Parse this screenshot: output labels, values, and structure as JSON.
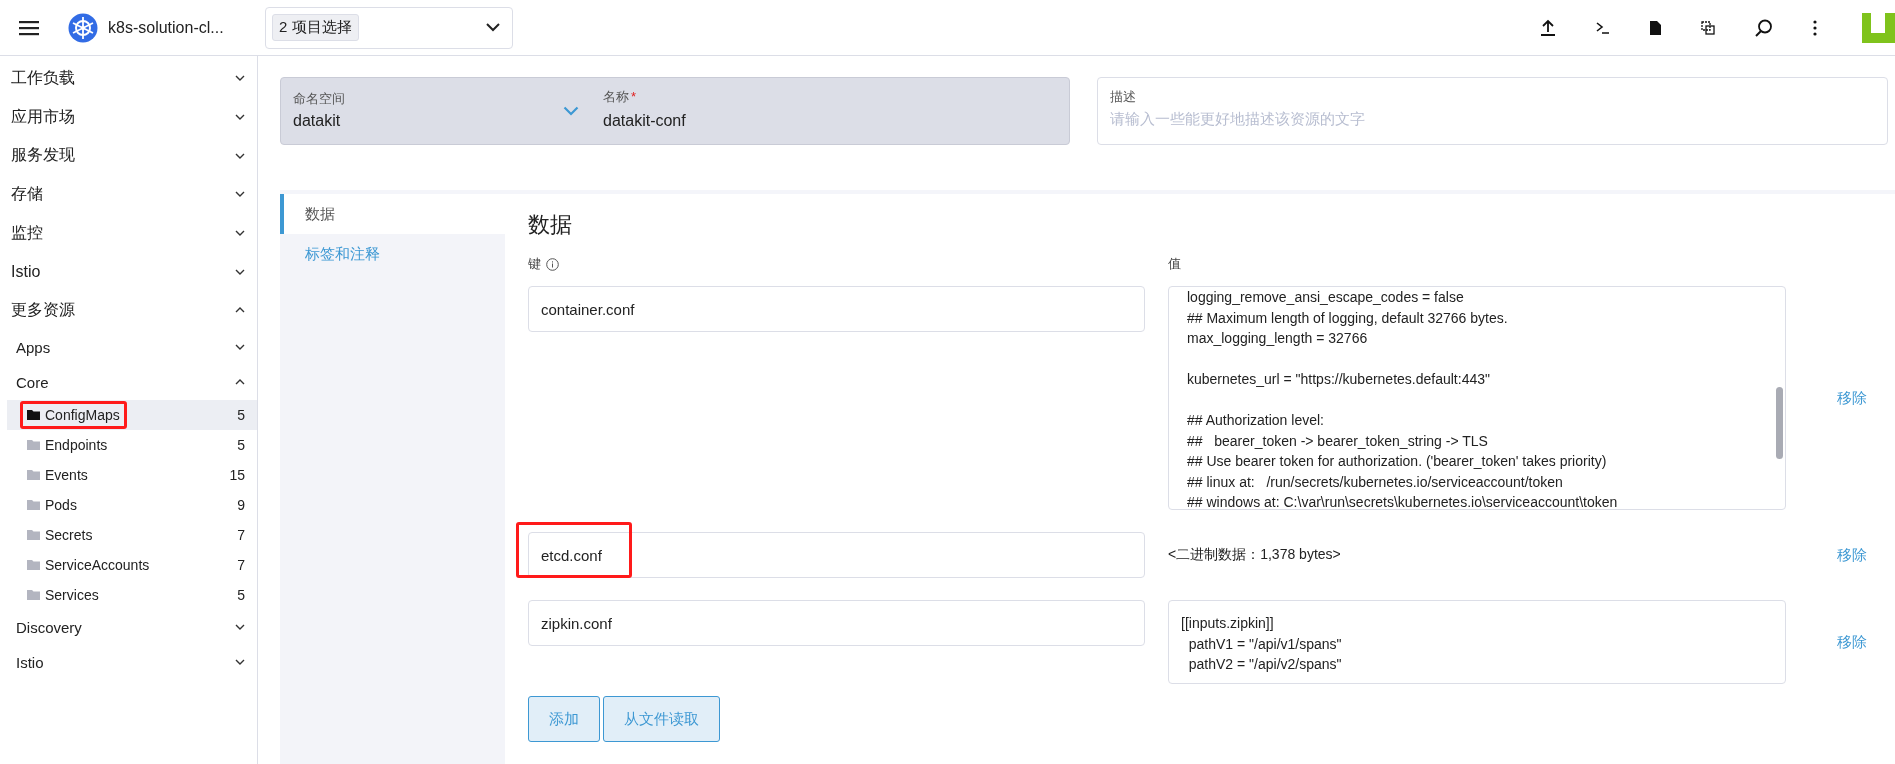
{
  "header": {
    "cluster_name": "k8s-solution-cl...",
    "project_select": {
      "value": "2 项目选择"
    }
  },
  "sidebar": {
    "items": [
      {
        "label": "工作负载",
        "expanded": false
      },
      {
        "label": "应用市场",
        "expanded": false
      },
      {
        "label": "服务发现",
        "expanded": false
      },
      {
        "label": "存储",
        "expanded": false
      },
      {
        "label": "监控",
        "expanded": false
      },
      {
        "label": "Istio",
        "expanded": false
      },
      {
        "label": "更多资源",
        "expanded": true,
        "children": [
          {
            "label": "Apps",
            "expanded": false
          },
          {
            "label": "Core",
            "expanded": true,
            "children": [
              {
                "label": "ConfigMaps",
                "count": "5",
                "selected": true,
                "annotated": true
              },
              {
                "label": "Endpoints",
                "count": "5",
                "selected": false,
                "annotated": false
              },
              {
                "label": "Events",
                "count": "15",
                "selected": false,
                "annotated": false
              },
              {
                "label": "Pods",
                "count": "9",
                "selected": false,
                "annotated": false
              },
              {
                "label": "Secrets",
                "count": "7",
                "selected": false,
                "annotated": false
              },
              {
                "label": "ServiceAccounts",
                "count": "7",
                "selected": false,
                "annotated": false
              },
              {
                "label": "Services",
                "count": "5",
                "selected": false,
                "annotated": false
              }
            ]
          },
          {
            "label": "Discovery",
            "expanded": false
          },
          {
            "label": "Istio",
            "expanded": false
          }
        ]
      }
    ]
  },
  "form": {
    "namespace": {
      "label": "命名空间",
      "value": "datakit"
    },
    "name": {
      "label": "名称",
      "required_mark": "*",
      "value": "datakit-conf"
    },
    "description": {
      "label": "描述",
      "placeholder": "请输入一些能更好地描述该资源的文字"
    }
  },
  "tabs": [
    {
      "label": "数据",
      "selected": true
    },
    {
      "label": "标签和注释",
      "selected": false
    }
  ],
  "data_panel": {
    "title": "数据",
    "key_header": "键",
    "value_header": "值",
    "entries": [
      {
        "key": "container.conf",
        "kind": "text",
        "annotated": false,
        "remove": "移除",
        "value_blocks": [
          [
            "logging_remove_ansi_escape_codes = false",
            "## Maximum length of logging, default 32766 bytes.",
            "max_logging_length = 32766"
          ],
          [
            "kubernetes_url = \"https://kubernetes.default:443\""
          ],
          [
            "## Authorization level:",
            "##   bearer_token -> bearer_token_string -> TLS",
            "## Use bearer token for authorization. ('bearer_token' takes priority)",
            "## linux at:   /run/secrets/kubernetes.io/serviceaccount/token",
            "## windows at: C:\\var\\run\\secrets\\kubernetes.io\\serviceaccount\\token"
          ]
        ]
      },
      {
        "key": "etcd.conf",
        "kind": "binary",
        "annotated": true,
        "remove": "移除",
        "value": "<二进制数据：1,378 bytes>"
      },
      {
        "key": "zipkin.conf",
        "kind": "text",
        "annotated": false,
        "remove": "移除",
        "value_blocks": [
          [
            "[[inputs.zipkin]]",
            "  pathV1 = \"/api/v1/spans\"",
            "  pathV2 = \"/api/v2/spans\""
          ]
        ]
      }
    ],
    "buttons": [
      "添加",
      "从文件读取"
    ]
  }
}
